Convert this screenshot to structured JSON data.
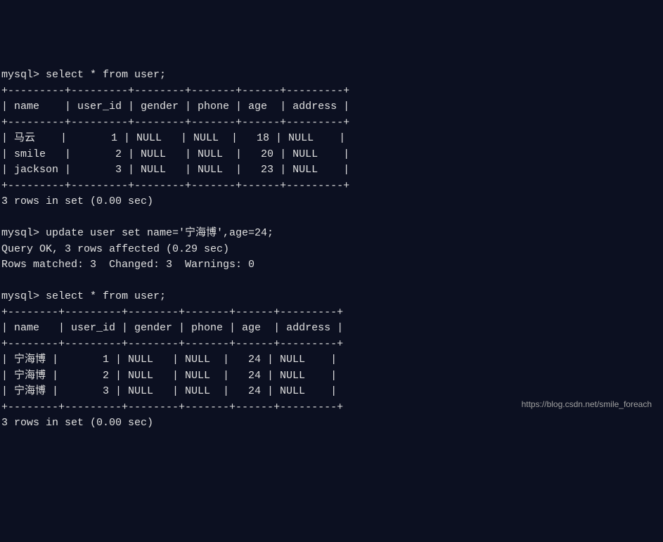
{
  "query1": {
    "prompt": "mysql> ",
    "command": "select * from user;",
    "table": {
      "border_top": "+---------+---------+--------+-------+------+---------+",
      "header_row": "| name    | user_id | gender | phone | age  | address |",
      "border_mid": "+---------+---------+--------+-------+------+---------+",
      "rows": [
        "| 马云    |       1 | NULL   | NULL  |   18 | NULL    |",
        "| smile   |       2 | NULL   | NULL  |   20 | NULL    |",
        "| jackson |       3 | NULL   | NULL  |   23 | NULL    |"
      ],
      "border_bot": "+---------+---------+--------+-------+------+---------+"
    },
    "result": "3 rows in set (0.00 sec)"
  },
  "query2": {
    "prompt": "mysql> ",
    "command": "update user set name='宁海博',age=24;",
    "result_line1": "Query OK, 3 rows affected (0.29 sec)",
    "result_line2": "Rows matched: 3  Changed: 3  Warnings: 0"
  },
  "query3": {
    "prompt": "mysql> ",
    "command": "select * from user;",
    "table": {
      "border_top": "+--------+---------+--------+-------+------+---------+",
      "header_row": "| name   | user_id | gender | phone | age  | address |",
      "border_mid": "+--------+---------+--------+-------+------+---------+",
      "rows": [
        "| 宁海博 |       1 | NULL   | NULL  |   24 | NULL    |",
        "| 宁海博 |       2 | NULL   | NULL  |   24 | NULL    |",
        "| 宁海博 |       3 | NULL   | NULL  |   24 | NULL    |"
      ],
      "border_bot": "+--------+---------+--------+-------+------+---------+"
    },
    "result": "3 rows in set (0.00 sec)"
  },
  "watermark": "https://blog.csdn.net/smile_foreach"
}
